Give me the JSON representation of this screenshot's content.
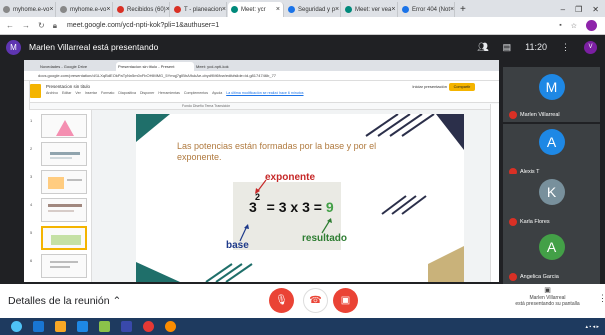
{
  "browser": {
    "tabs": [
      {
        "label": "myhome.e-vo",
        "favicon_color": "#5f6368"
      },
      {
        "label": "myhome.e-vo",
        "favicon_color": "#5f6368"
      },
      {
        "label": "Recibidos (60)",
        "favicon_color": "#d93025"
      },
      {
        "label": "T - planeacion",
        "favicon_color": "#d93025"
      },
      {
        "label": "Meet: ycr",
        "favicon_color": "#00897b",
        "active": true
      },
      {
        "label": "Seguridad y p",
        "favicon_color": "#1a73e8"
      },
      {
        "label": "Meet: ver vea",
        "favicon_color": "#00897b"
      },
      {
        "label": "Error 404 (Not",
        "favicon_color": "#1a73e8"
      }
    ],
    "new_tab_glyph": "+",
    "url": "meet.google.com/ycd-npti-kok?pli=1&authuser=1"
  },
  "meet": {
    "presenter_initial": "M",
    "presenting_text": "Marlen Villarreal está presentando",
    "time": "11:20",
    "user_initial": "V",
    "details_label": "Detalles de la reunión",
    "presenting_info_line1": "Marlen Villarreal",
    "presenting_info_line2": "está presentando su pantalla",
    "participants": [
      {
        "initial": "M",
        "name": "Marlen Villarreal",
        "color": "#1e88e5"
      },
      {
        "initial": "A",
        "name": "Alexis T",
        "color": "#1e88e5"
      },
      {
        "initial": "K",
        "name": "Karla Flores",
        "color": "#78909c"
      },
      {
        "initial": "A",
        "name": "Angelica Garcia",
        "color": "#43a047"
      }
    ]
  },
  "shared": {
    "tabs": [
      "Novedades - Google Drive",
      "Presentacion sin titulo - Present",
      "Meet: ycd-npti-kok"
    ],
    "url": "docs.google.com/presentation/d/1LXqBdEOkPaTyNn5m0xFbOHlMMG_5Ymqj7gIBhA9ukAe-cbyd9M6fvw/edit#slide=id.g8174746b_77",
    "doc_title": "Presentacion sin titulo",
    "menu": [
      "Archivo",
      "Editar",
      "Ver",
      "Insertar",
      "Formato",
      "Diapositiva",
      "Disponer",
      "Herramientas",
      "Complementos",
      "Ayuda",
      "La última modificación se realizó hace 6 minutos"
    ],
    "present_label": "Iniciar presentación",
    "share_label": "Compartir",
    "toolbar_text": "Fondo   Diseño   Tema   Transición",
    "thumbnail_numbers": [
      "1",
      "2",
      "3",
      "4",
      "5",
      "6",
      "7",
      "8"
    ],
    "slide": {
      "text": "Las potencias están formadas por la base y por el exponente.",
      "equation_base": "3",
      "equation_exp": "2",
      "equation_rest": " = 3 x 3 = ",
      "equation_result": "9",
      "label_exponente": "exponente",
      "label_base": "base",
      "label_resultado": "resultado"
    }
  },
  "colors": {
    "end_call": "#ea4335",
    "mic_off": "#ea4335",
    "slide_text": "#b07a3f"
  }
}
